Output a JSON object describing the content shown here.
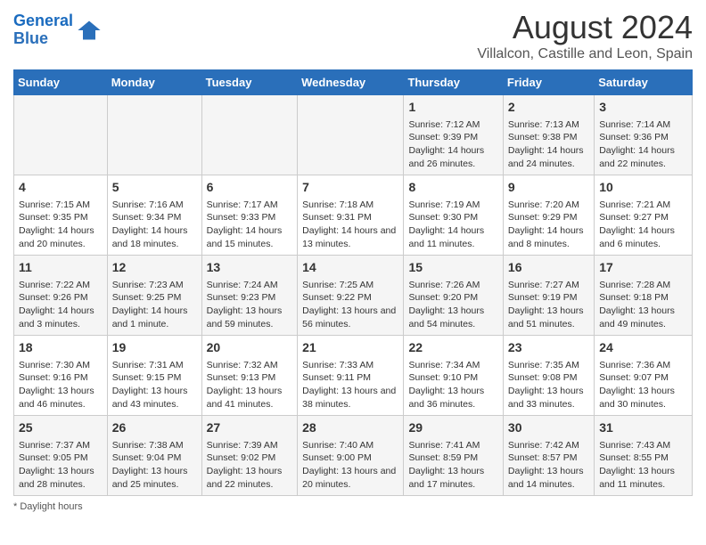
{
  "header": {
    "logo_line1": "General",
    "logo_line2": "Blue",
    "main_title": "August 2024",
    "subtitle": "Villalcon, Castille and Leon, Spain"
  },
  "days_of_week": [
    "Sunday",
    "Monday",
    "Tuesday",
    "Wednesday",
    "Thursday",
    "Friday",
    "Saturday"
  ],
  "weeks": [
    [
      {
        "day": "",
        "info": ""
      },
      {
        "day": "",
        "info": ""
      },
      {
        "day": "",
        "info": ""
      },
      {
        "day": "",
        "info": ""
      },
      {
        "day": "1",
        "info": "Sunrise: 7:12 AM\nSunset: 9:39 PM\nDaylight: 14 hours and 26 minutes."
      },
      {
        "day": "2",
        "info": "Sunrise: 7:13 AM\nSunset: 9:38 PM\nDaylight: 14 hours and 24 minutes."
      },
      {
        "day": "3",
        "info": "Sunrise: 7:14 AM\nSunset: 9:36 PM\nDaylight: 14 hours and 22 minutes."
      }
    ],
    [
      {
        "day": "4",
        "info": "Sunrise: 7:15 AM\nSunset: 9:35 PM\nDaylight: 14 hours and 20 minutes."
      },
      {
        "day": "5",
        "info": "Sunrise: 7:16 AM\nSunset: 9:34 PM\nDaylight: 14 hours and 18 minutes."
      },
      {
        "day": "6",
        "info": "Sunrise: 7:17 AM\nSunset: 9:33 PM\nDaylight: 14 hours and 15 minutes."
      },
      {
        "day": "7",
        "info": "Sunrise: 7:18 AM\nSunset: 9:31 PM\nDaylight: 14 hours and 13 minutes."
      },
      {
        "day": "8",
        "info": "Sunrise: 7:19 AM\nSunset: 9:30 PM\nDaylight: 14 hours and 11 minutes."
      },
      {
        "day": "9",
        "info": "Sunrise: 7:20 AM\nSunset: 9:29 PM\nDaylight: 14 hours and 8 minutes."
      },
      {
        "day": "10",
        "info": "Sunrise: 7:21 AM\nSunset: 9:27 PM\nDaylight: 14 hours and 6 minutes."
      }
    ],
    [
      {
        "day": "11",
        "info": "Sunrise: 7:22 AM\nSunset: 9:26 PM\nDaylight: 14 hours and 3 minutes."
      },
      {
        "day": "12",
        "info": "Sunrise: 7:23 AM\nSunset: 9:25 PM\nDaylight: 14 hours and 1 minute."
      },
      {
        "day": "13",
        "info": "Sunrise: 7:24 AM\nSunset: 9:23 PM\nDaylight: 13 hours and 59 minutes."
      },
      {
        "day": "14",
        "info": "Sunrise: 7:25 AM\nSunset: 9:22 PM\nDaylight: 13 hours and 56 minutes."
      },
      {
        "day": "15",
        "info": "Sunrise: 7:26 AM\nSunset: 9:20 PM\nDaylight: 13 hours and 54 minutes."
      },
      {
        "day": "16",
        "info": "Sunrise: 7:27 AM\nSunset: 9:19 PM\nDaylight: 13 hours and 51 minutes."
      },
      {
        "day": "17",
        "info": "Sunrise: 7:28 AM\nSunset: 9:18 PM\nDaylight: 13 hours and 49 minutes."
      }
    ],
    [
      {
        "day": "18",
        "info": "Sunrise: 7:30 AM\nSunset: 9:16 PM\nDaylight: 13 hours and 46 minutes."
      },
      {
        "day": "19",
        "info": "Sunrise: 7:31 AM\nSunset: 9:15 PM\nDaylight: 13 hours and 43 minutes."
      },
      {
        "day": "20",
        "info": "Sunrise: 7:32 AM\nSunset: 9:13 PM\nDaylight: 13 hours and 41 minutes."
      },
      {
        "day": "21",
        "info": "Sunrise: 7:33 AM\nSunset: 9:11 PM\nDaylight: 13 hours and 38 minutes."
      },
      {
        "day": "22",
        "info": "Sunrise: 7:34 AM\nSunset: 9:10 PM\nDaylight: 13 hours and 36 minutes."
      },
      {
        "day": "23",
        "info": "Sunrise: 7:35 AM\nSunset: 9:08 PM\nDaylight: 13 hours and 33 minutes."
      },
      {
        "day": "24",
        "info": "Sunrise: 7:36 AM\nSunset: 9:07 PM\nDaylight: 13 hours and 30 minutes."
      }
    ],
    [
      {
        "day": "25",
        "info": "Sunrise: 7:37 AM\nSunset: 9:05 PM\nDaylight: 13 hours and 28 minutes."
      },
      {
        "day": "26",
        "info": "Sunrise: 7:38 AM\nSunset: 9:04 PM\nDaylight: 13 hours and 25 minutes."
      },
      {
        "day": "27",
        "info": "Sunrise: 7:39 AM\nSunset: 9:02 PM\nDaylight: 13 hours and 22 minutes."
      },
      {
        "day": "28",
        "info": "Sunrise: 7:40 AM\nSunset: 9:00 PM\nDaylight: 13 hours and 20 minutes."
      },
      {
        "day": "29",
        "info": "Sunrise: 7:41 AM\nSunset: 8:59 PM\nDaylight: 13 hours and 17 minutes."
      },
      {
        "day": "30",
        "info": "Sunrise: 7:42 AM\nSunset: 8:57 PM\nDaylight: 13 hours and 14 minutes."
      },
      {
        "day": "31",
        "info": "Sunrise: 7:43 AM\nSunset: 8:55 PM\nDaylight: 13 hours and 11 minutes."
      }
    ]
  ],
  "footer": {
    "note": "Daylight hours"
  }
}
